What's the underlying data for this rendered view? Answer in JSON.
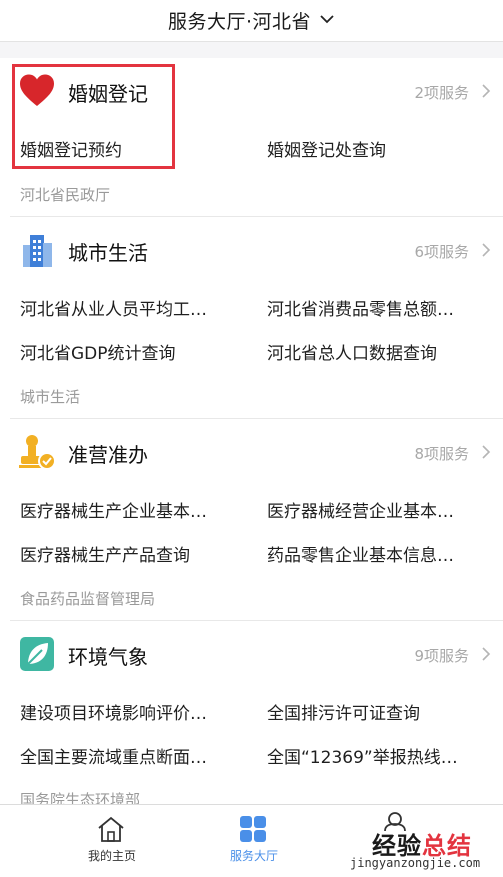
{
  "header": {
    "title": "服务大厅·河北省"
  },
  "cards": [
    {
      "title": "婚姻登记",
      "count": "2项服务",
      "icon": "heart-icon",
      "services": [
        "婚姻登记预约",
        "婚姻登记处查询"
      ],
      "department": "河北省民政厅"
    },
    {
      "title": "城市生活",
      "count": "6项服务",
      "icon": "building-icon",
      "services": [
        "河北省从业人员平均工…",
        "河北省消费品零售总额…",
        "河北省GDP统计查询",
        "河北省总人口数据查询"
      ],
      "department": "城市生活"
    },
    {
      "title": "准营准办",
      "count": "8项服务",
      "icon": "stamp-icon",
      "services": [
        "医疗器械生产企业基本…",
        "医疗器械经营企业基本…",
        "医疗器械生产产品查询",
        "药品零售企业基本信息…"
      ],
      "department": "食品药品监督管理局"
    },
    {
      "title": "环境气象",
      "count": "9项服务",
      "icon": "leaf-icon",
      "services": [
        "建设项目环境影响评价…",
        "全国排污许可证查询",
        "全国主要流域重点断面…",
        "全国“12369”举报热线…"
      ],
      "department": "国务院生态环境部"
    }
  ],
  "tabbar": {
    "home_label": "我的主页",
    "hall_label": "服务大厅"
  },
  "watermark": {
    "big_a": "经验",
    "big_b": "总结",
    "small": "jingyanzongjie.com"
  },
  "colors": {
    "accent_blue": "#4a8fe8",
    "highlight_red": "#e3343f",
    "heart_red": "#d7262b",
    "stamp_yellow": "#f2b024",
    "leaf_teal": "#3fb7a2"
  }
}
